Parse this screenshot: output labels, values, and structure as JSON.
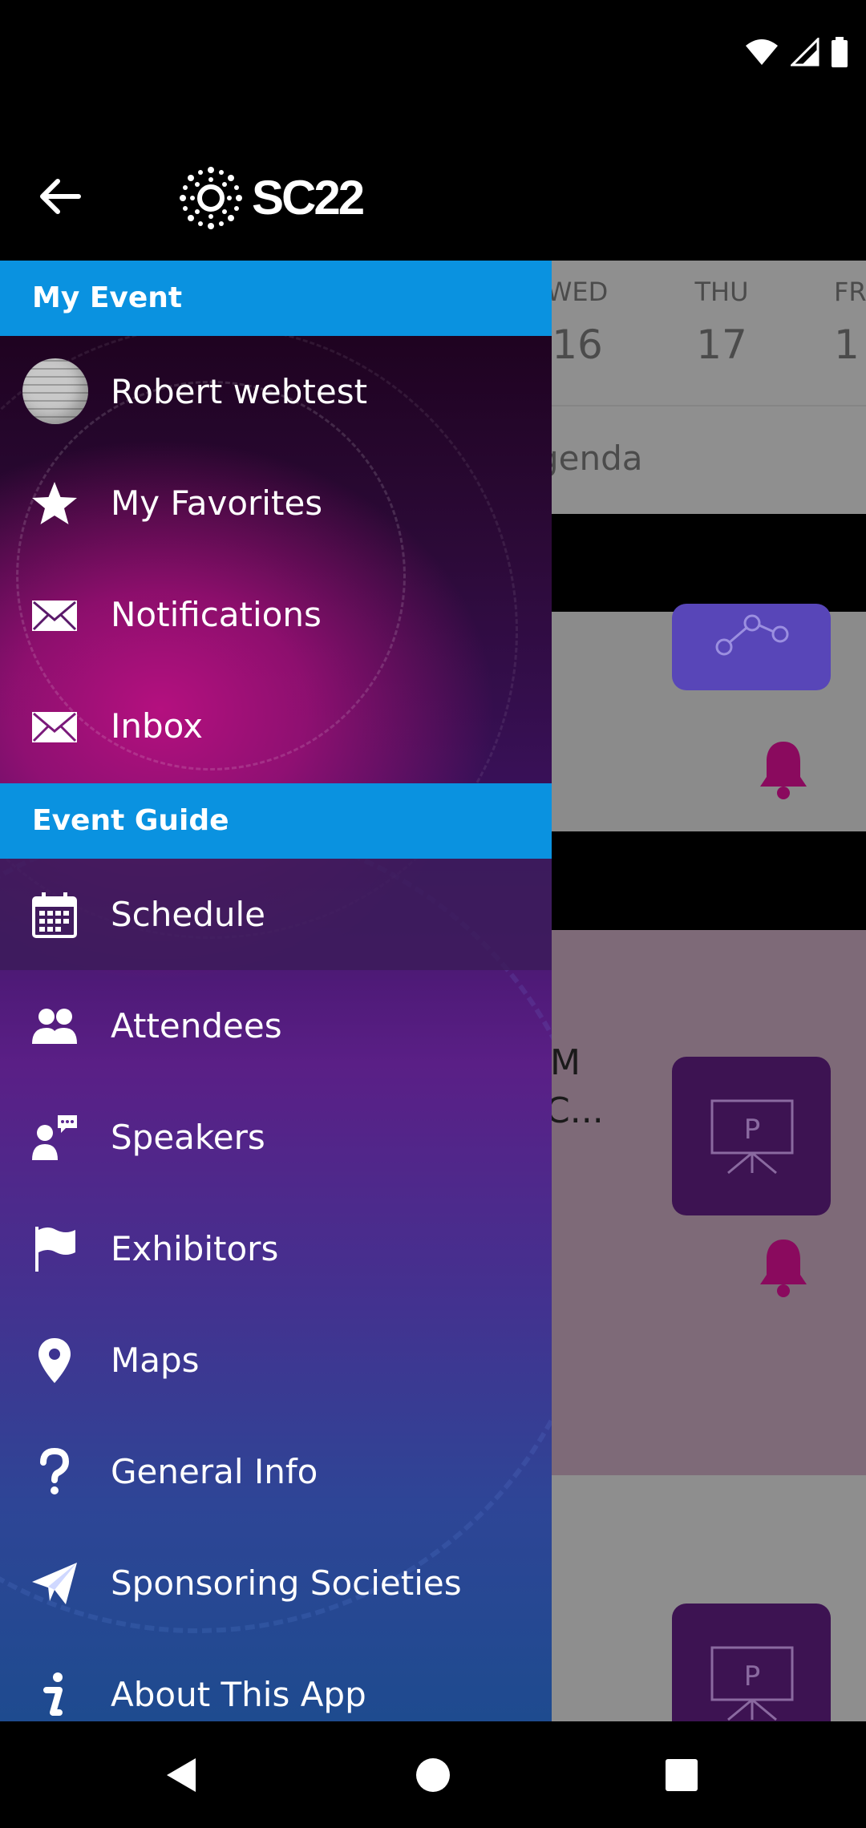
{
  "header": {
    "logo_text": "SC22"
  },
  "background": {
    "days": [
      {
        "name": "WED",
        "num": "16"
      },
      {
        "name": "THU",
        "num": "17"
      },
      {
        "name": "FR",
        "num": "1"
      }
    ],
    "agenda_text": "genda",
    "card_text_line1": "M",
    "card_text_line2": "C..."
  },
  "drawer": {
    "my_event_header": "My Event",
    "my_event_items": [
      {
        "label": "Robert webtest",
        "icon": "avatar"
      },
      {
        "label": "My Favorites",
        "icon": "star-icon"
      },
      {
        "label": "Notifications",
        "icon": "envelope-icon"
      },
      {
        "label": "Inbox",
        "icon": "envelope-icon"
      }
    ],
    "event_guide_header": "Event Guide",
    "event_guide_items": [
      {
        "label": "Schedule",
        "icon": "calendar-icon",
        "selected": true
      },
      {
        "label": "Attendees",
        "icon": "people-icon"
      },
      {
        "label": "Speakers",
        "icon": "speaker-icon"
      },
      {
        "label": "Exhibitors",
        "icon": "flag-icon"
      },
      {
        "label": "Maps",
        "icon": "map-pin-icon"
      },
      {
        "label": "General Info",
        "icon": "question-icon"
      },
      {
        "label": "Sponsoring Societies",
        "icon": "paper-plane-icon"
      },
      {
        "label": "About This App",
        "icon": "info-icon"
      }
    ]
  },
  "colors": {
    "section_header": "#0a92e0",
    "accent_magenta": "#b4107f",
    "tile_purple": "#5846b8",
    "tile_dark_purple": "#3d1352",
    "bell_magenta": "#8a0a5e"
  }
}
